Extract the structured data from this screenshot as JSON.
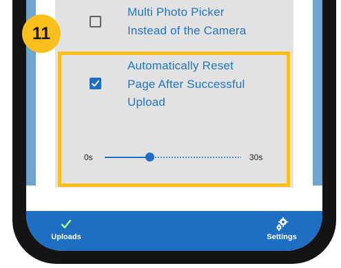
{
  "step_badge": "11",
  "settings": {
    "multi_photo_picker": {
      "checked": false,
      "label_line1": "Multi Photo Picker",
      "label_line2": "Instead of the Camera"
    },
    "auto_reset": {
      "checked": true,
      "label_line1": "Automatically Reset",
      "label_line2": "Page After Successful",
      "label_line3": "Upload",
      "slider": {
        "min_label": "0s",
        "max_label": "30s",
        "value_fraction": 0.33
      }
    }
  },
  "bottom_nav": {
    "uploads": {
      "label": "Uploads",
      "icon": "checkmark-icon"
    },
    "settings": {
      "label": "Settings",
      "icon": "gears-icon"
    }
  },
  "colors": {
    "accent": "#1e6fc3",
    "highlight": "#f9bf1b",
    "setting_bg": "#e2e2e2",
    "screen_bg": "#6ea4cd",
    "phone_frame": "#141414"
  }
}
